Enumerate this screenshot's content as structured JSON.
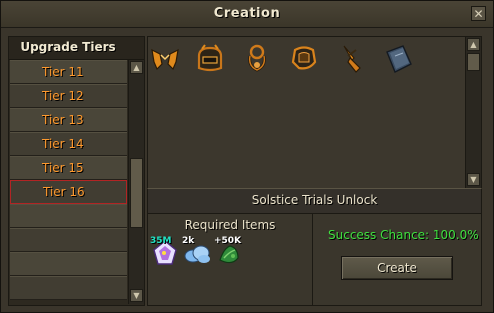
{
  "window": {
    "title": "Creation",
    "close_icon": "close-icon"
  },
  "tiers": {
    "header": "Upgrade Tiers",
    "items": [
      {
        "label": "Tier 11",
        "selected": false
      },
      {
        "label": "Tier 12",
        "selected": false
      },
      {
        "label": "Tier 13",
        "selected": false
      },
      {
        "label": "Tier 14",
        "selected": false
      },
      {
        "label": "Tier 15",
        "selected": false
      },
      {
        "label": "Tier 16",
        "selected": true
      },
      {
        "label": "",
        "selected": false
      },
      {
        "label": "",
        "selected": false
      },
      {
        "label": "",
        "selected": false
      },
      {
        "label": "",
        "selected": false
      }
    ]
  },
  "items": [
    {
      "icon": "gloves-icon"
    },
    {
      "icon": "helm-icon"
    },
    {
      "icon": "amulet-icon"
    },
    {
      "icon": "boots-icon"
    },
    {
      "icon": "dagger-icon"
    },
    {
      "icon": "book-icon"
    }
  ],
  "unlock": {
    "label": "Solstice Trials Unlock"
  },
  "requirements": {
    "title": "Required Items",
    "items": [
      {
        "icon": "crystal-icon",
        "quantity": "35M",
        "quantity_color": "#21e2c4"
      },
      {
        "icon": "cloud-icon",
        "quantity": "2k",
        "quantity_color": "#ffffff"
      },
      {
        "icon": "herb-icon",
        "quantity": "+50K",
        "quantity_color": "#ffffff"
      }
    ]
  },
  "success": {
    "text": "Success Chance: 100.0%",
    "color": "#3fe03f"
  },
  "create_label": "Create",
  "colors": {
    "tier_text": "#ff9a2e",
    "selected_border": "#b22424"
  }
}
